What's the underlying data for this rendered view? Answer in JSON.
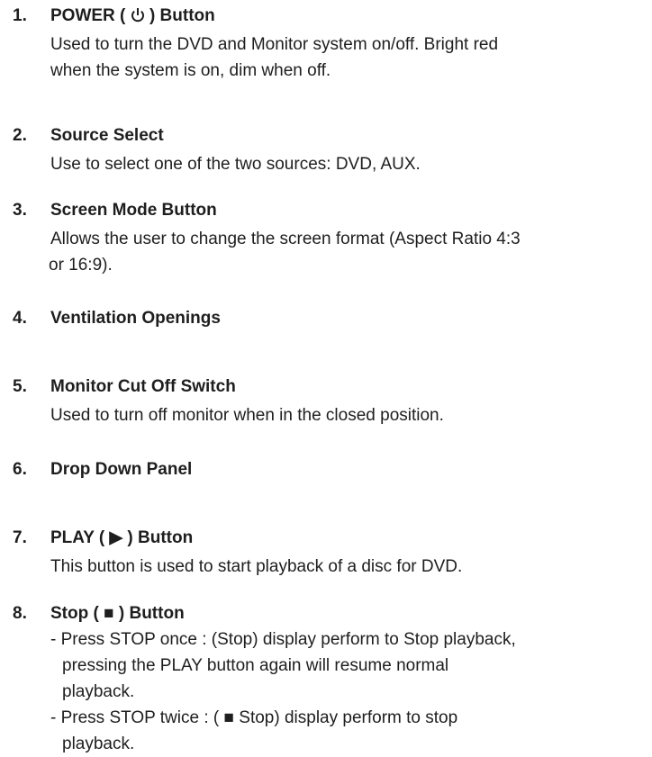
{
  "items": [
    {
      "number": "1.",
      "title_before": "POWER (",
      "title_icon": "power-icon",
      "title_after": ") Button",
      "lines": [
        "Used to turn the DVD and Monitor system on/off. Bright red",
        "when the system is on, dim when off."
      ]
    },
    {
      "number": "2.",
      "title": "Source Select",
      "lines": [
        "Use to select one of the two sources: DVD,  AUX."
      ]
    },
    {
      "number": "3.",
      "title": "Screen Mode Button",
      "lines": [
        "Allows the user to change the screen format (Aspect Ratio 4:3",
        "or 16:9)."
      ]
    },
    {
      "number": "4.",
      "title": "Ventilation Openings"
    },
    {
      "number": "5.",
      "title": "Monitor Cut Off Switch",
      "lines": [
        "Used to turn off monitor when in the closed position."
      ]
    },
    {
      "number": "6.",
      "title": "Drop Down Panel"
    },
    {
      "number": "7.",
      "title_before": "PLAY (",
      "title_symbol": "▶",
      "title_after": ") Button",
      "lines": [
        "This button is used to start playback of a disc for DVD."
      ]
    },
    {
      "number": "8.",
      "title_before": "Stop (",
      "title_symbol": "■",
      "title_after": ") Button",
      "subitems": [
        {
          "lines": [
            "- Press STOP once : (Stop) display perform to Stop playback,",
            "pressing the PLAY button again will resume normal",
            "playback."
          ]
        },
        {
          "line1_before": "- Press STOP twice : (",
          "line1_symbol": "■",
          "line1_after": "Stop) display perform to stop",
          "lines_rest": [
            "playback."
          ]
        }
      ]
    }
  ]
}
